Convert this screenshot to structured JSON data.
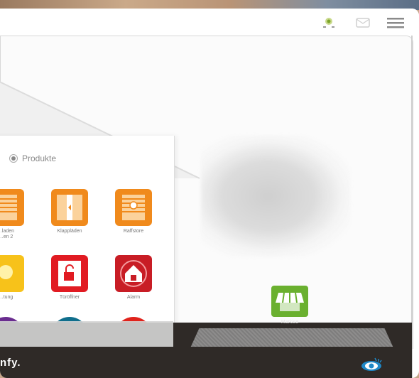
{
  "topbar": {
    "icons": [
      "home-connect-icon",
      "mail-icon",
      "menu-icon"
    ]
  },
  "panel": {
    "filter_label": "Produkte",
    "tiles": [
      {
        "name": "rollladen-tile",
        "label": "...laden\n...en 2",
        "color": "#f08a1c",
        "icon": "roller-shutter-icon"
      },
      {
        "name": "klappladen-tile",
        "label": "Klappläden",
        "color": "#f08a1c",
        "icon": "shutters-icon"
      },
      {
        "name": "raffstore-tile",
        "label": "Raffstore",
        "color": "#f08a1c",
        "icon": "venetian-blind-icon"
      },
      {
        "name": "beleuchtung-tile",
        "label": "...tung",
        "color": "#f7c21a",
        "icon": "light-icon"
      },
      {
        "name": "tueroeffner-tile",
        "label": "Türöffner",
        "color": "#e11b22",
        "icon": "door-lock-icon"
      },
      {
        "name": "alarm-tile",
        "label": "Alarm",
        "color": "#c81d25",
        "icon": "alarm-house-icon"
      },
      {
        "name": "heizung-tile",
        "label": "",
        "color": "#6a2d8f",
        "icon": "thermometer-icon"
      },
      {
        "name": "tuer-tile",
        "label": "",
        "color": "#0f6e8c",
        "icon": "door-icon"
      },
      {
        "name": "sensor-tile",
        "label": "",
        "color": "#e0231c",
        "icon": "sensor-icon"
      }
    ]
  },
  "scene": {
    "markise_label": "Markise"
  },
  "footer": {
    "brand": "nfy."
  }
}
